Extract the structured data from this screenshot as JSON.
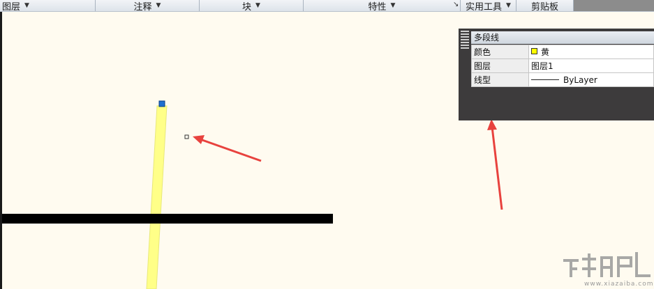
{
  "ribbon": {
    "panels": [
      {
        "label": "图层"
      },
      {
        "label": "注释"
      },
      {
        "label": "块"
      },
      {
        "label": "特性"
      },
      {
        "label": "实用工具"
      },
      {
        "label": "剪贴板"
      }
    ]
  },
  "quick_properties": {
    "title": "多段线",
    "rows": [
      {
        "label": "颜色",
        "value": "黄",
        "swatch_color": "#ffff00"
      },
      {
        "label": "图层",
        "value": "图层1"
      },
      {
        "label": "线型",
        "value": "ByLayer"
      }
    ]
  },
  "watermark": {
    "caption": "www.xiazaiba.com"
  },
  "colors": {
    "canvas": "#fffbf0",
    "polyline": "#ffff88",
    "grip": "#1e6fd0",
    "annotation_arrow": "#e8423e",
    "horizontal_line": "#000000"
  }
}
